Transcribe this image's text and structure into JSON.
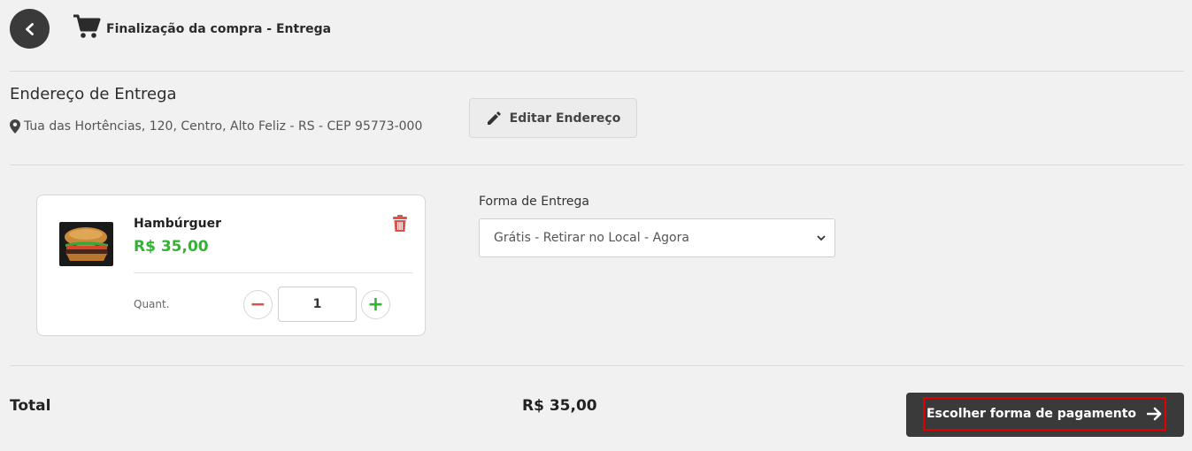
{
  "header": {
    "title": "Finalização da compra - Entrega",
    "back_icon": "chevron-left-icon",
    "cart_icon": "shopping-cart-icon"
  },
  "address": {
    "heading": "Endereço de Entrega",
    "text": "Tua das Hortências, 120, Centro, Alto Feliz - RS - CEP 95773-000",
    "edit_label": "Editar Endereço"
  },
  "cart": {
    "items": [
      {
        "name": "Hambúrguer",
        "price": "R$ 35,00",
        "quantity_label": "Quant.",
        "quantity": "1"
      }
    ]
  },
  "delivery": {
    "label": "Forma de Entrega",
    "selected": "Grátis - Retirar no Local - Agora"
  },
  "footer": {
    "total_label": "Total",
    "total_value": "R$ 35,00",
    "pay_label": "Escolher forma de pagamento"
  },
  "colors": {
    "dark": "#3a3a3a",
    "price_green": "#2fb52f",
    "minus_red": "#d9534f",
    "trash_red": "#d9534f",
    "highlight_red": "#e30000"
  }
}
